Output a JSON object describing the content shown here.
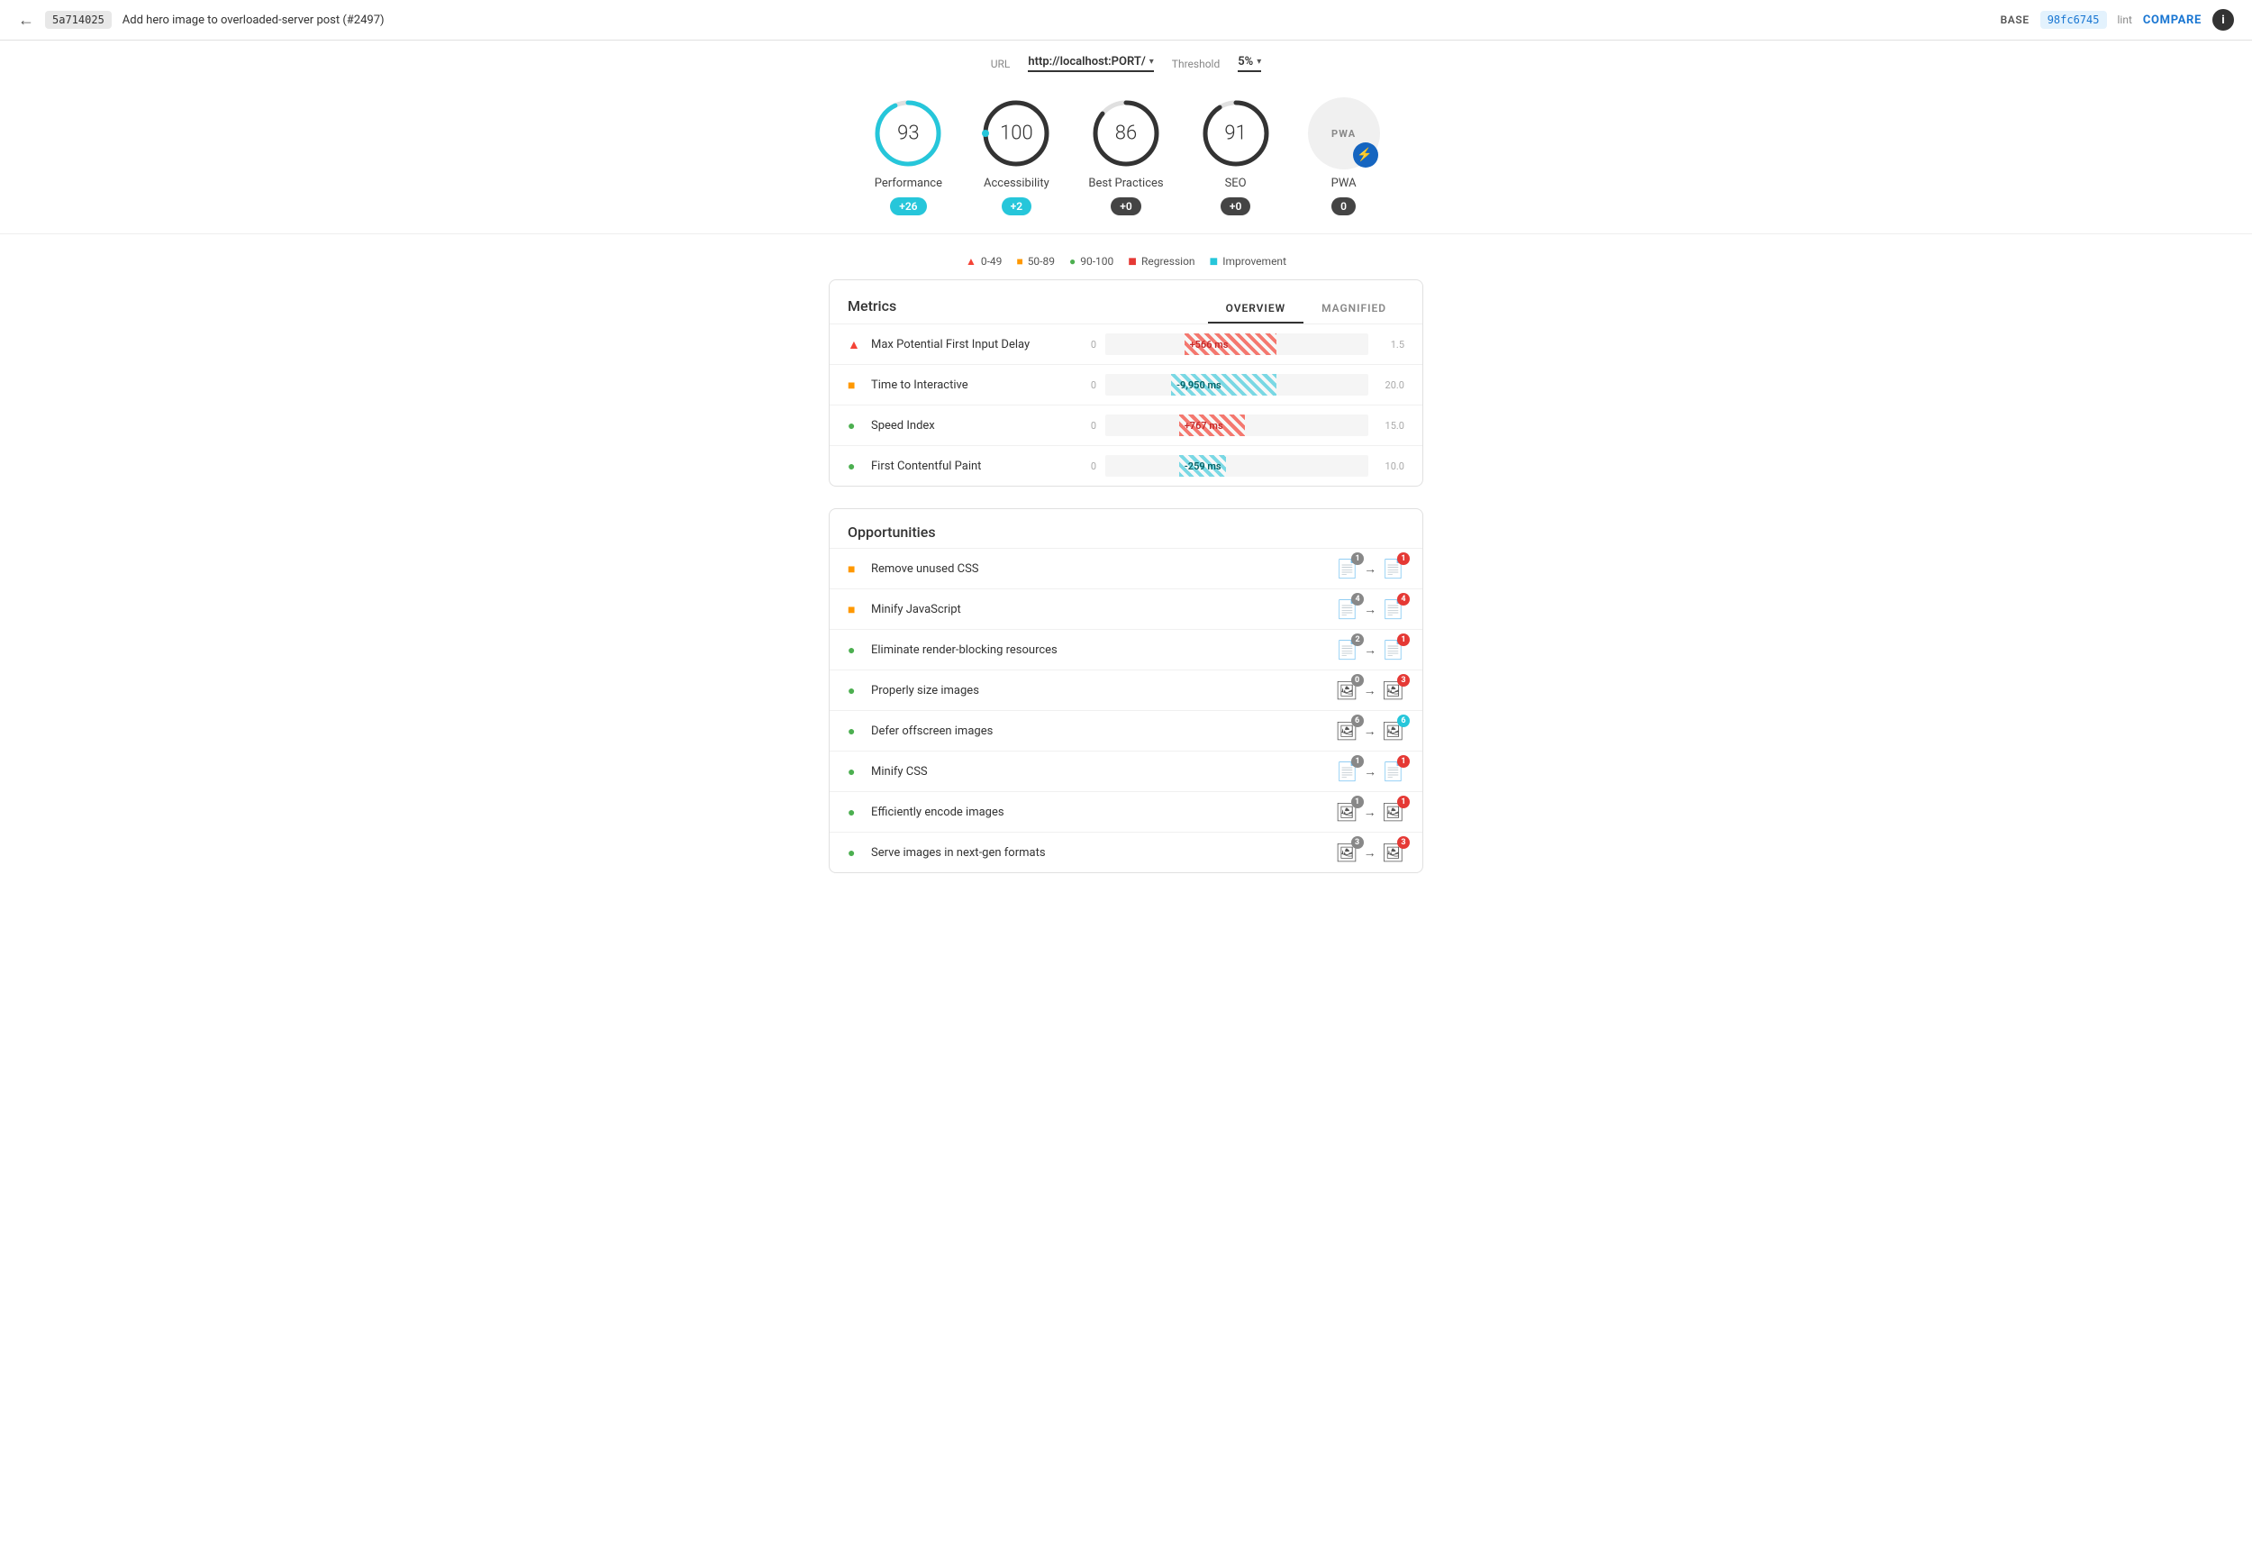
{
  "header": {
    "back_label": "←",
    "commit_base": "5a714025",
    "title": "Add hero image to overloaded-server post (#2497)",
    "base_label": "BASE",
    "commit_compare": "98fc6745",
    "lint_label": "lint",
    "compare_label": "COMPARE",
    "info_label": "i"
  },
  "url_bar": {
    "url_label": "URL",
    "url_value": "http://localhost:PORT/",
    "threshold_label": "Threshold",
    "threshold_value": "5%"
  },
  "scores": [
    {
      "id": "performance",
      "value": "93",
      "label": "Performance",
      "delta": "+26",
      "delta_type": "blue",
      "color": "#26c6da",
      "bg_color": "#26c6da",
      "ring_pct": 93
    },
    {
      "id": "accessibility",
      "value": "100",
      "label": "Accessibility",
      "delta": "+2",
      "delta_type": "blue",
      "color": "#333",
      "bg_color": "#26c6da",
      "ring_pct": 100
    },
    {
      "id": "best-practices",
      "value": "86",
      "label": "Best Practices",
      "delta": "+0",
      "delta_type": "dark",
      "color": "#333",
      "bg_color": "#444",
      "ring_pct": 86
    },
    {
      "id": "seo",
      "value": "91",
      "label": "SEO",
      "delta": "+0",
      "delta_type": "dark",
      "color": "#333",
      "bg_color": "#444",
      "ring_pct": 91
    }
  ],
  "legend": [
    {
      "icon": "▲",
      "color": "#f44336",
      "label": "0-49"
    },
    {
      "icon": "■",
      "color": "#ff9800",
      "label": "50-89"
    },
    {
      "icon": "●",
      "color": "#4caf50",
      "label": "90-100"
    },
    {
      "icon": "■",
      "color": "#e53935",
      "label": "Regression"
    },
    {
      "icon": "■",
      "color": "#26c6da",
      "label": "Improvement"
    }
  ],
  "metrics": {
    "title": "Metrics",
    "tab_overview": "OVERVIEW",
    "tab_magnified": "MAGNIFIED",
    "rows": [
      {
        "id": "max-potential-fid",
        "icon": "▲",
        "icon_color": "#f44336",
        "name": "Max Potential First Input Delay",
        "zero": "0",
        "bar_type": "regression",
        "bar_label": "+566 ms",
        "bar_left": "30%",
        "bar_width": "35%",
        "max": "1.5"
      },
      {
        "id": "time-to-interactive",
        "icon": "■",
        "icon_color": "#ff9800",
        "name": "Time to Interactive",
        "zero": "0",
        "bar_type": "improvement",
        "bar_label": "-9,950 ms",
        "bar_left": "25%",
        "bar_width": "40%",
        "max": "20.0"
      },
      {
        "id": "speed-index",
        "icon": "●",
        "icon_color": "#4caf50",
        "name": "Speed Index",
        "zero": "0",
        "bar_type": "regression",
        "bar_label": "+767 ms",
        "bar_left": "28%",
        "bar_width": "25%",
        "max": "15.0"
      },
      {
        "id": "first-contentful-paint",
        "icon": "●",
        "icon_color": "#4caf50",
        "name": "First Contentful Paint",
        "zero": "0",
        "bar_type": "improvement",
        "bar_label": "-259 ms",
        "bar_left": "28%",
        "bar_width": "18%",
        "max": "10.0"
      }
    ]
  },
  "opportunities": {
    "title": "Opportunities",
    "rows": [
      {
        "id": "remove-unused-css",
        "icon": "■",
        "icon_color": "#ff9800",
        "name": "Remove unused CSS",
        "icon_type": "file",
        "base_count": "1",
        "compare_count": "1",
        "compare_badge_color": "red"
      },
      {
        "id": "minify-js",
        "icon": "■",
        "icon_color": "#ff9800",
        "name": "Minify JavaScript",
        "icon_type": "file",
        "base_count": "4",
        "compare_count": "4",
        "compare_badge_color": "red"
      },
      {
        "id": "eliminate-render-blocking",
        "icon": "●",
        "icon_color": "#4caf50",
        "name": "Eliminate render-blocking resources",
        "icon_type": "file",
        "base_count": "2",
        "compare_count": "1",
        "compare_badge_color": "red"
      },
      {
        "id": "properly-size-images",
        "icon": "●",
        "icon_color": "#4caf50",
        "name": "Properly size images",
        "icon_type": "image",
        "base_count": "0",
        "compare_count": "3",
        "compare_badge_color": "red"
      },
      {
        "id": "defer-offscreen-images",
        "icon": "●",
        "icon_color": "#4caf50",
        "name": "Defer offscreen images",
        "icon_type": "image",
        "base_count": "6",
        "compare_count": "6",
        "compare_badge_color": "blue"
      },
      {
        "id": "minify-css",
        "icon": "●",
        "icon_color": "#4caf50",
        "name": "Minify CSS",
        "icon_type": "file",
        "base_count": "1",
        "compare_count": "1",
        "compare_badge_color": "red"
      },
      {
        "id": "efficiently-encode-images",
        "icon": "●",
        "icon_color": "#4caf50",
        "name": "Efficiently encode images",
        "icon_type": "image",
        "base_count": "1",
        "compare_count": "1",
        "compare_badge_color": "red"
      },
      {
        "id": "serve-next-gen-formats",
        "icon": "●",
        "icon_color": "#4caf50",
        "name": "Serve images in next-gen formats",
        "icon_type": "image",
        "base_count": "3",
        "compare_count": "3",
        "compare_badge_color": "red"
      }
    ]
  }
}
